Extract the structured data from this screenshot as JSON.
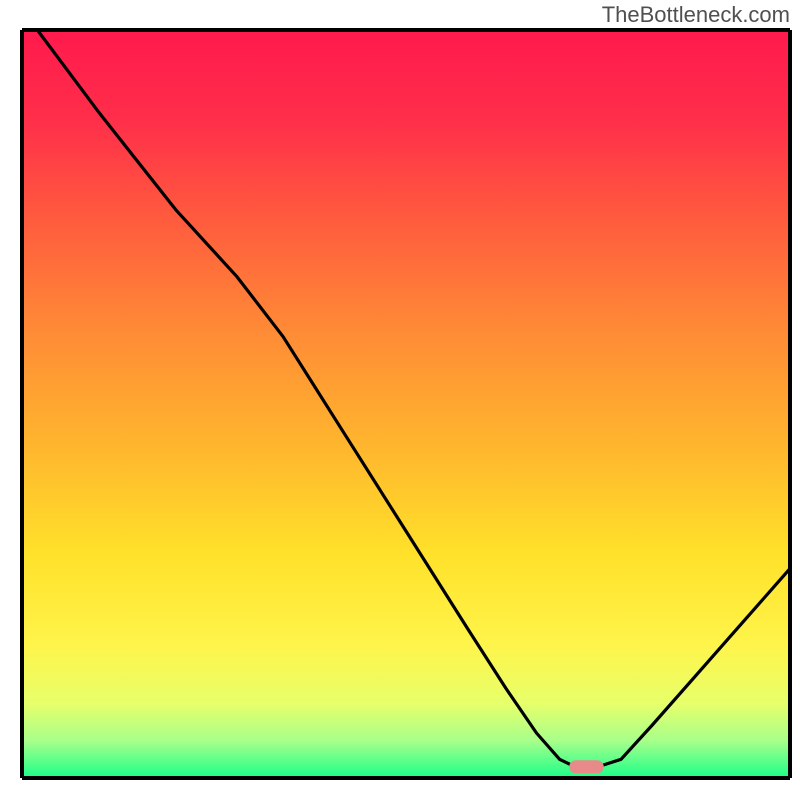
{
  "watermark": "TheBottleneck.com",
  "chart_data": {
    "type": "line",
    "title": "",
    "xlabel": "",
    "ylabel": "",
    "xlim": [
      0,
      100
    ],
    "ylim": [
      0,
      100
    ],
    "background": {
      "type": "vertical-gradient",
      "stops": [
        {
          "offset": 0.0,
          "color": "#ff1a4d"
        },
        {
          "offset": 0.12,
          "color": "#ff2e4a"
        },
        {
          "offset": 0.25,
          "color": "#ff5a3e"
        },
        {
          "offset": 0.4,
          "color": "#ff8a36"
        },
        {
          "offset": 0.55,
          "color": "#ffb42e"
        },
        {
          "offset": 0.7,
          "color": "#ffe12a"
        },
        {
          "offset": 0.82,
          "color": "#fff44a"
        },
        {
          "offset": 0.9,
          "color": "#e7ff6a"
        },
        {
          "offset": 0.95,
          "color": "#a8ff8a"
        },
        {
          "offset": 1.0,
          "color": "#1aff89"
        }
      ]
    },
    "series": [
      {
        "name": "bottleneck-curve",
        "color": "#000000",
        "points": [
          {
            "x": 2,
            "y": 100
          },
          {
            "x": 10,
            "y": 89
          },
          {
            "x": 20,
            "y": 76
          },
          {
            "x": 28,
            "y": 67
          },
          {
            "x": 34,
            "y": 59
          },
          {
            "x": 42,
            "y": 46
          },
          {
            "x": 50,
            "y": 33
          },
          {
            "x": 58,
            "y": 20
          },
          {
            "x": 63,
            "y": 12
          },
          {
            "x": 67,
            "y": 6
          },
          {
            "x": 70,
            "y": 2.5
          },
          {
            "x": 72,
            "y": 1.5
          },
          {
            "x": 75,
            "y": 1.5
          },
          {
            "x": 78,
            "y": 2.5
          },
          {
            "x": 82,
            "y": 7
          },
          {
            "x": 88,
            "y": 14
          },
          {
            "x": 94,
            "y": 21
          },
          {
            "x": 100,
            "y": 28
          }
        ]
      }
    ],
    "marker": {
      "name": "optimal-point",
      "x": 73.5,
      "y": 1.5,
      "color": "#e88a8a",
      "width": 4.5
    },
    "axes": {
      "show_ticks": false,
      "border_color": "#000000",
      "border_width": 4
    }
  }
}
